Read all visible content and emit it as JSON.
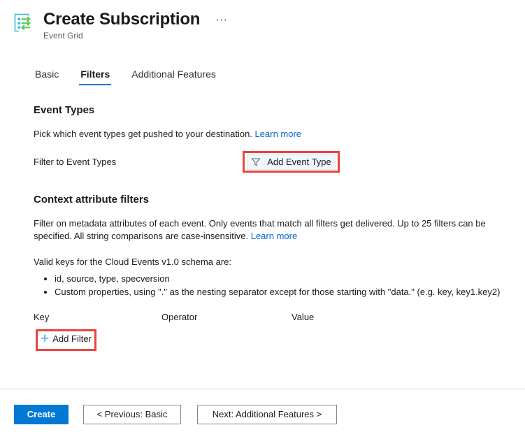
{
  "header": {
    "icon_name": "event-grid-icon",
    "title": "Create Subscription",
    "subtitle": "Event Grid",
    "more_menu_label": "⋯"
  },
  "tabs": [
    {
      "label": "Basic",
      "active": false
    },
    {
      "label": "Filters",
      "active": true
    },
    {
      "label": "Additional Features",
      "active": false
    }
  ],
  "event_types": {
    "heading": "Event Types",
    "description": "Pick which event types get pushed to your destination.",
    "learn_more": "Learn more",
    "filter_label": "Filter to Event Types",
    "add_button_label": "Add Event Type",
    "add_button_icon": "funnel-icon"
  },
  "context_filters": {
    "heading": "Context attribute filters",
    "description": "Filter on metadata attributes of each event. Only events that match all filters get delivered. Up to 25 filters can be specified. All string comparisons are case-insensitive.",
    "learn_more": "Learn more",
    "keys_intro": "Valid keys for the Cloud Events v1.0 schema are:",
    "key_bullets": [
      "id, source, type, specversion",
      "Custom properties, using \".\" as the nesting separator except for those starting with \"data.\" (e.g. key, key1.key2)"
    ],
    "columns": {
      "key": "Key",
      "operator": "Operator",
      "value": "Value"
    },
    "add_filter_label": "Add Filter",
    "add_filter_icon": "plus-icon"
  },
  "footer": {
    "create_label": "Create",
    "previous_label": "< Previous: Basic",
    "next_label": "Next: Additional Features >"
  },
  "colors": {
    "accent": "#0078d4",
    "link": "#0066cc",
    "annotation": "#e8453c",
    "command_button_bg": "#eff6fc",
    "plus_icon": "#4a9ae0"
  }
}
